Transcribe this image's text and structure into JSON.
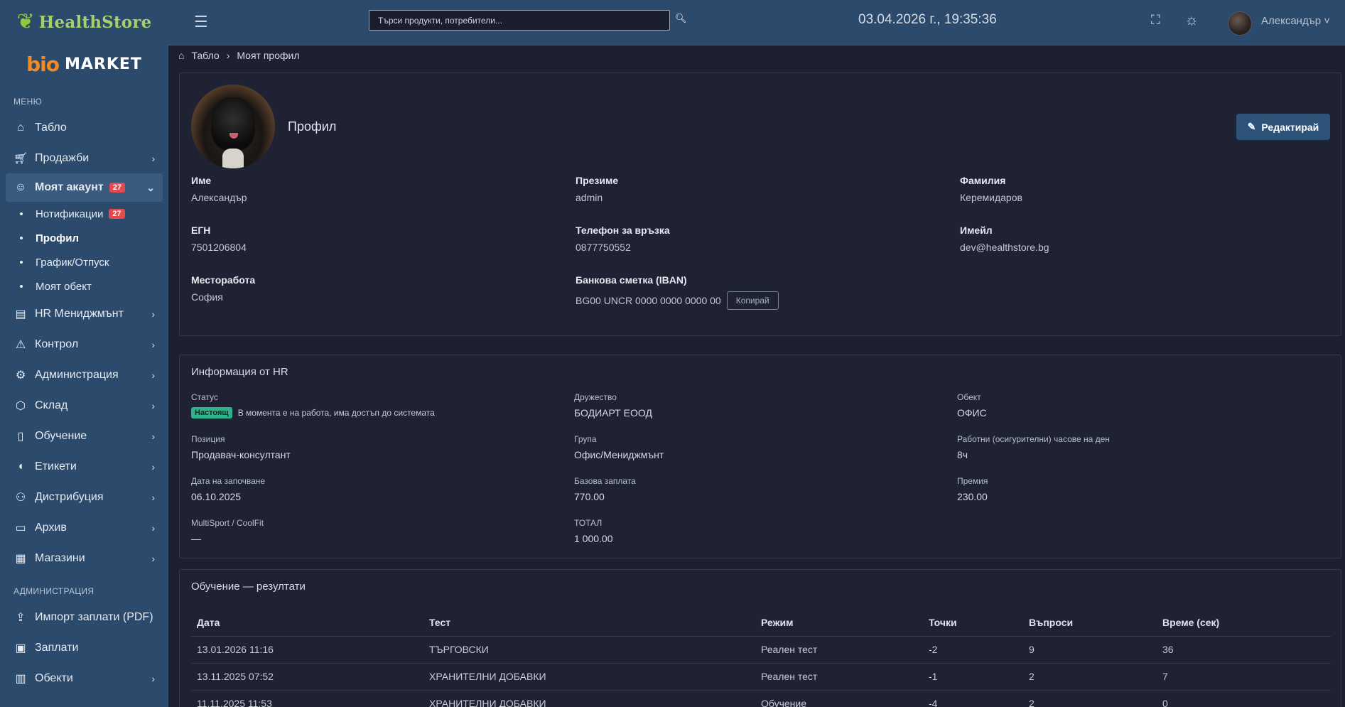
{
  "brand": {
    "healthstore": "HealthStore",
    "bio": "bio",
    "market": "MARKET"
  },
  "sidebar": {
    "section_menu": "МЕНЮ",
    "section_admin": "АДМИНИСТРАЦИЯ",
    "items": [
      {
        "label": "Табло",
        "icon": "home-icon"
      },
      {
        "label": "Продажби",
        "icon": "cart-icon"
      },
      {
        "label": "Моят акаунт",
        "icon": "user-icon",
        "badge": "27"
      },
      {
        "label": "HR Мениджмънт",
        "icon": "briefcase-icon"
      },
      {
        "label": "Контрол",
        "icon": "warning-icon"
      },
      {
        "label": "Администрация",
        "icon": "gear-icon"
      },
      {
        "label": "Склад",
        "icon": "box-icon"
      },
      {
        "label": "Обучение",
        "icon": "book-icon"
      },
      {
        "label": "Етикети",
        "icon": "tag-icon"
      },
      {
        "label": "Дистрибуция",
        "icon": "users-icon"
      },
      {
        "label": "Архив",
        "icon": "archive-icon"
      },
      {
        "label": "Магазини",
        "icon": "store-icon"
      }
    ],
    "subitems": [
      {
        "label": "Нотификации",
        "badge": "27"
      },
      {
        "label": "Профил"
      },
      {
        "label": "График/Отпуск"
      },
      {
        "label": "Моят обект"
      }
    ],
    "admin_items": [
      {
        "label": "Импорт заплати (PDF)",
        "icon": "upload-icon"
      },
      {
        "label": "Заплати",
        "icon": "wallet-icon"
      },
      {
        "label": "Обекти",
        "icon": "building-icon"
      }
    ]
  },
  "topbar": {
    "search_placeholder": "Търси продукти, потребители...",
    "datetime": "03.04.2026 г., 19:35:36",
    "user_name": "Александър ˅"
  },
  "breadcrumb": {
    "home": "Табло",
    "separator": "›",
    "current": "Моят профил"
  },
  "profile": {
    "title": "Профил",
    "edit_label": "Редактирай",
    "fields": {
      "first_name": {
        "label": "Име",
        "value": "Александър"
      },
      "middle_name": {
        "label": "Презиме",
        "value": "admin"
      },
      "last_name": {
        "label": "Фамилия",
        "value": "Керемидаров"
      },
      "egn": {
        "label": "ЕГН",
        "value": "7501206804"
      },
      "phone": {
        "label": "Телефон за връзка",
        "value": "0877750552"
      },
      "email": {
        "label": "Имейл",
        "value": "dev@healthstore.bg"
      },
      "workplace": {
        "label": "Месторабота",
        "value": "София"
      },
      "iban": {
        "label": "Банкова сметка (IBAN)",
        "value": "BG00 UNCR 0000 0000 0000 00",
        "copy_label": "Копирай"
      }
    }
  },
  "hr": {
    "title": "Информация от HR",
    "status_label": "Статус",
    "status_badge": "Настоящ",
    "status_text": "В момента е на работа, има достъп до системата",
    "company_label": "Дружество",
    "company": "БОДИАРТ ЕООД",
    "site_label": "Обект",
    "site": "ОФИС",
    "position_label": "Позиция",
    "position": "Продавач-консултант",
    "group_label": "Група",
    "group": "Офис/Мениджмънт",
    "hours_label": "Работни (осигурителни) часове на ден",
    "hours": "8ч",
    "start_label": "Дата на започване",
    "start": "06.10.2025",
    "salary_label": "Базова заплата",
    "salary": "770.00",
    "bonus_label": "Премия",
    "bonus": "230.00",
    "multisport_label": "MultiSport / CoolFit",
    "multisport": "—",
    "total_label": "ТОТАЛ",
    "total": "1 000.00"
  },
  "training": {
    "title": "Обучение — резултати",
    "headers": [
      "Дата",
      "Тест",
      "Режим",
      "Точки",
      "Въпроси",
      "Време (сек)"
    ],
    "rows": [
      [
        "13.01.2026 11:16",
        "ТЪРГОВСКИ",
        "Реален тест",
        "-2",
        "9",
        "36"
      ],
      [
        "13.11.2025 07:52",
        "ХРАНИТЕЛНИ ДОБАВКИ",
        "Реален тест",
        "-1",
        "2",
        "7"
      ],
      [
        "11.11.2025 11:53",
        "ХРАНИТЕЛНИ ДОБАВКИ",
        "Обучение",
        "-4",
        "2",
        "0"
      ]
    ]
  },
  "colors": {
    "sidebar": "#2c4a6c",
    "background": "#1c2030",
    "badge": "#e5484d",
    "status": "#2fb38a",
    "primary_button": "#2d5378"
  }
}
